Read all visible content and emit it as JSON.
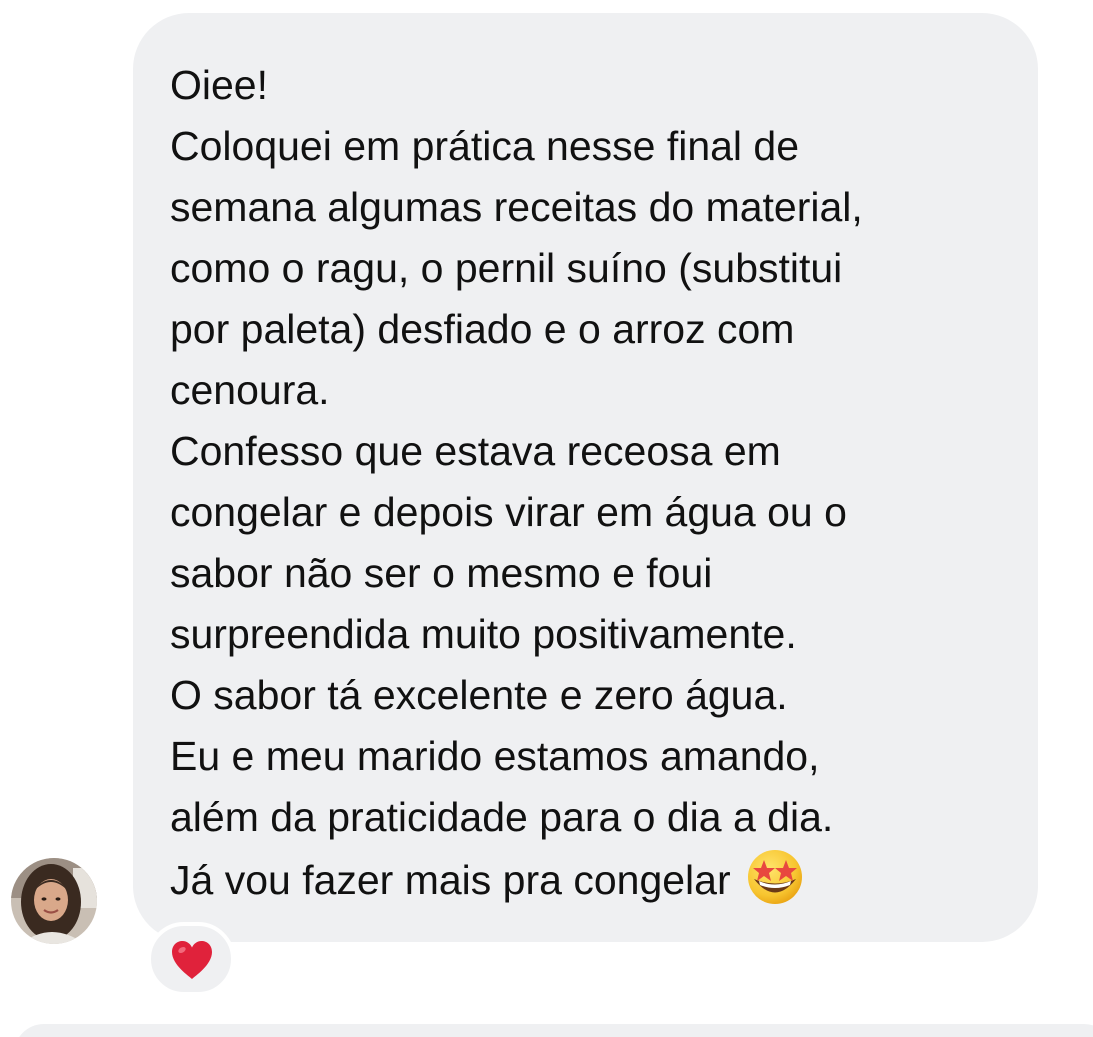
{
  "message": {
    "paragraphs": [
      [
        "Oiee!"
      ],
      [
        "Coloquei em prática nesse final de",
        "semana algumas receitas do material,",
        "como o ragu, o pernil suíno (substitui",
        "por paleta) desfiado e o arroz com",
        "cenoura."
      ],
      [
        "Confesso que estava receosa em",
        "congelar e depois virar em água ou o",
        "sabor não ser o mesmo e foui",
        "surpreendida muito positivamente."
      ],
      [
        "O sabor tá excelente e zero água."
      ],
      [
        "Eu e meu marido estamos amando,",
        "além da praticidade para o dia a dia."
      ],
      [
        "Já vou fazer mais pra congelar"
      ]
    ],
    "trailing_emoji": "star-struck-icon"
  },
  "reaction": {
    "icon": "red-heart-icon",
    "color": "#e0223b"
  },
  "colors": {
    "bubble": "#eff0f2",
    "text": "#111111"
  }
}
